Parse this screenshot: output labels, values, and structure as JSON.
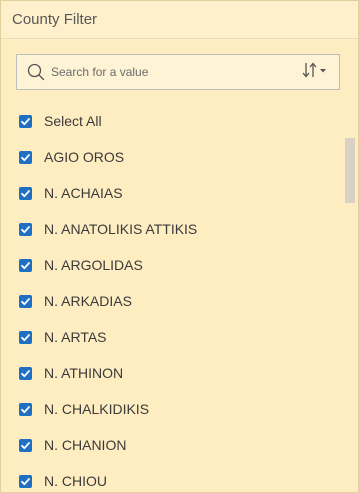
{
  "header": {
    "title": "County Filter"
  },
  "search": {
    "placeholder": "Search for a value",
    "icon": "search-icon",
    "sort_icon": "sort-icon"
  },
  "colors": {
    "panel_bg": "#fff0cc",
    "checkbox": "#1f6fc4"
  },
  "list": {
    "items": [
      {
        "label": "Select All",
        "checked": true
      },
      {
        "label": "AGIO OROS",
        "checked": true
      },
      {
        "label": "N. ACHAIAS",
        "checked": true
      },
      {
        "label": "N. ANATOLIKIS ATTIKIS",
        "checked": true
      },
      {
        "label": "N. ARGOLIDAS",
        "checked": true
      },
      {
        "label": "N. ARKADIAS",
        "checked": true
      },
      {
        "label": "N. ARTAS",
        "checked": true
      },
      {
        "label": "N. ATHINON",
        "checked": true
      },
      {
        "label": "N. CHALKIDIKIS",
        "checked": true
      },
      {
        "label": "N. CHANION",
        "checked": true
      },
      {
        "label": "N. CHIOU",
        "checked": true
      }
    ]
  }
}
